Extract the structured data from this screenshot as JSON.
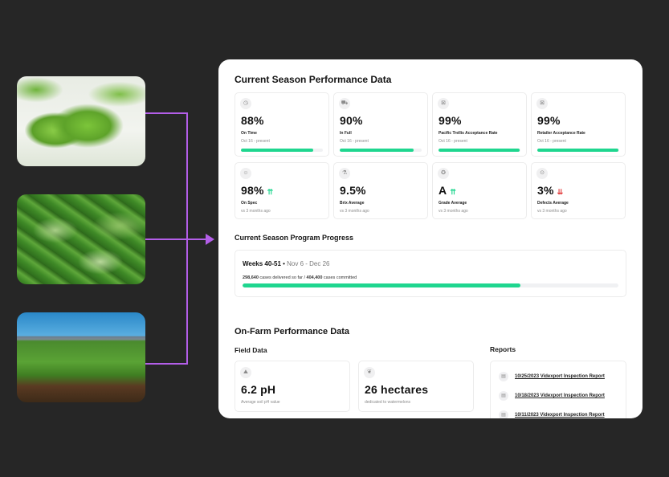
{
  "photos": [
    {
      "alt": "butter lettuce head"
    },
    {
      "alt": "spinach leaves in field"
    },
    {
      "alt": "lettuce field with mountains"
    }
  ],
  "accent_color": "#b35ee8",
  "progress_color": "#1fd68f",
  "season": {
    "title": "Current Season Performance Data",
    "metrics_row1": [
      {
        "icon": "stopwatch-icon",
        "glyph": "◷",
        "value": "88%",
        "label": "On Time",
        "sub": "Oct 16 - present",
        "progress": 0.88
      },
      {
        "icon": "truck-icon",
        "glyph": "⛟",
        "value": "90%",
        "label": "In Full",
        "sub": "Oct 16 - present",
        "progress": 0.9
      },
      {
        "icon": "acceptance-icon",
        "glyph": "⊠",
        "value": "99%",
        "label": "Pacific Trellis Acceptance Rate",
        "sub": "Oct 16 - present",
        "progress": 0.99
      },
      {
        "icon": "acceptance-icon",
        "glyph": "⊠",
        "value": "99%",
        "label": "Retailer Acceptance Rate",
        "sub": "Oct 16 - present",
        "progress": 0.99
      }
    ],
    "metrics_row2": [
      {
        "icon": "smile-icon",
        "glyph": "☺",
        "value": "98%",
        "trend": "up",
        "trend_glyph": "⇈",
        "label": "On Spec",
        "sub": "vs 3 months ago"
      },
      {
        "icon": "brix-icon",
        "glyph": "⚗",
        "value": "9.5%",
        "trend": "",
        "trend_glyph": "",
        "label": "Brix Average",
        "sub": "vs 3 months ago"
      },
      {
        "icon": "grade-icon",
        "glyph": "✪",
        "value": "A",
        "trend": "up",
        "trend_glyph": "⇈",
        "label": "Grade Average",
        "sub": "vs 3 months ago"
      },
      {
        "icon": "defect-icon",
        "glyph": "⊙",
        "value": "3%",
        "trend": "down",
        "trend_glyph": "⇊",
        "label": "Defects Average",
        "sub": "vs 3 months ago"
      }
    ]
  },
  "program": {
    "title": "Current Season Program Progress",
    "weeks": "Weeks 40-51",
    "separator": " • ",
    "dates": "Nov 6 - Dec 26",
    "delivered": "298,640",
    "delivered_text": " cases delivered so far / ",
    "committed": "404,400",
    "committed_text": " cases committed",
    "progress": 0.7385
  },
  "farm": {
    "title": "On-Farm Performance Data",
    "field_title": "Field Data",
    "field_cards": [
      {
        "icon": "soil-icon",
        "glyph": "⛰",
        "value": "6.2 pH",
        "sub": "Average soil pH value"
      },
      {
        "icon": "leaf-icon",
        "glyph": "❦",
        "value": "26 hectares",
        "sub": "dedicated to watermelons"
      }
    ],
    "reports_title": "Reports",
    "reports": [
      {
        "icon": "document-icon",
        "glyph": "▤",
        "label": "10/25/2023 Videxport Inspection Report"
      },
      {
        "icon": "document-icon",
        "glyph": "▤",
        "label": "10/18/2023 Videxport Inspection Report"
      },
      {
        "icon": "document-icon",
        "glyph": "▤",
        "label": "10/11/2023 Videxport Inspection Report"
      }
    ]
  }
}
